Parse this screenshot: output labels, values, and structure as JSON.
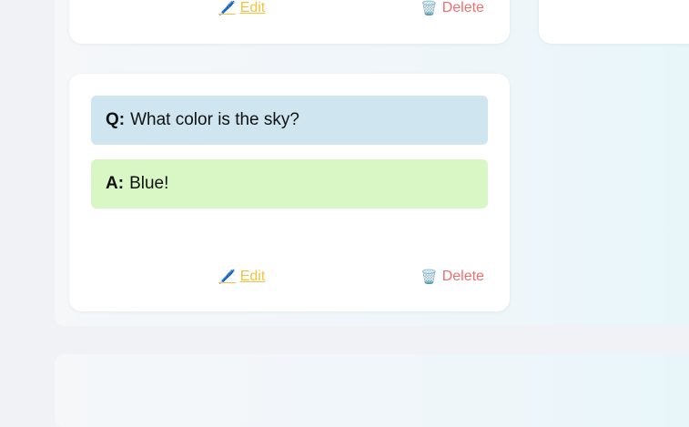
{
  "cards": [
    {
      "actions": {
        "edit_icon": "pencil-icon",
        "edit_label": "Edit",
        "delete_icon": "trash-icon",
        "delete_label": "Delete"
      }
    },
    {
      "question_prefix": "Q:",
      "question": "What color is the sky?",
      "answer_prefix": "A:",
      "answer": "Blue!",
      "actions": {
        "edit_icon": "pencil-icon",
        "edit_label": "Edit",
        "delete_icon": "trash-icon",
        "delete_label": "Delete"
      }
    }
  ],
  "colors": {
    "question_bg": "#cfe6f0",
    "answer_bg": "#d8f7c5",
    "edit": "#f3c33f",
    "delete": "#ef6f6f"
  }
}
